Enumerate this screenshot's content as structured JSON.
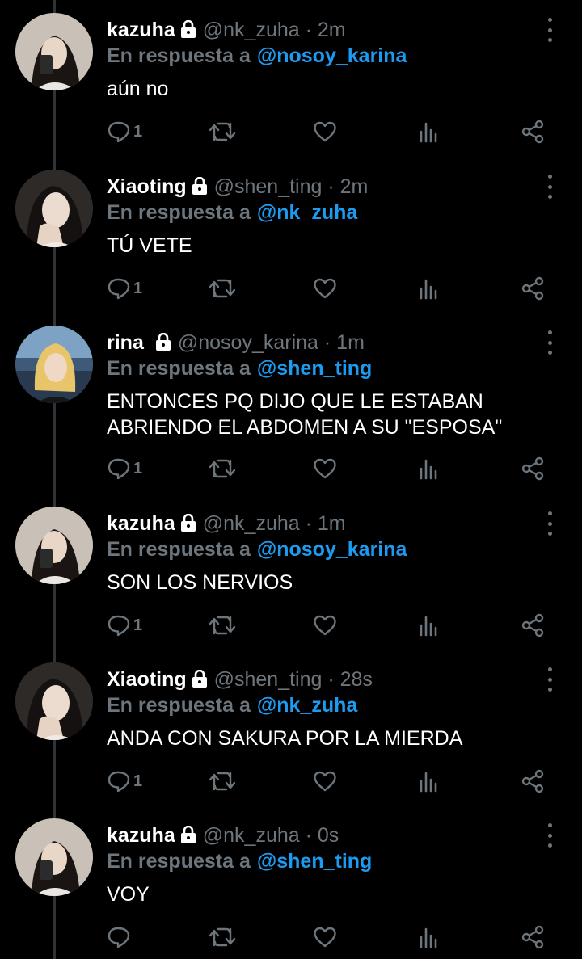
{
  "theme": {
    "background": "#000000",
    "text": "#ffffff",
    "muted": "#6e767d",
    "accent": "#1d9bf0"
  },
  "reply_prefix": "En respuesta a",
  "tweets": [
    {
      "name": "kazuha",
      "handle": "@nk_zuha · 2m",
      "reply_to": "@nosoy_karina",
      "text": "aún no",
      "reply_count": "1",
      "avatar": "kazuha"
    },
    {
      "name": "Xiaoting",
      "handle": "@shen_ting · 2m",
      "reply_to": "@nk_zuha",
      "text": "TÚ VETE",
      "reply_count": "1",
      "avatar": "xiaoting"
    },
    {
      "name": "rina",
      "handle": "@nosoy_karina · 1m",
      "reply_to": "@shen_ting",
      "text": "ENTONCES PQ DIJO QUE LE ESTABAN\nABRIENDO EL ABDOMEN A SU \"ESPOSA\"",
      "reply_count": "1",
      "avatar": "rina"
    },
    {
      "name": "kazuha",
      "handle": "@nk_zuha · 1m",
      "reply_to": "@nosoy_karina",
      "text": "SON LOS NERVIOS",
      "reply_count": "1",
      "avatar": "kazuha"
    },
    {
      "name": "Xiaoting",
      "handle": "@shen_ting · 28s",
      "reply_to": "@nk_zuha",
      "text": "ANDA CON SAKURA POR LA MIERDA",
      "reply_count": "1",
      "avatar": "xiaoting"
    },
    {
      "name": "kazuha",
      "handle": "@nk_zuha · 0s",
      "reply_to": "@shen_ting",
      "text": "VOY",
      "reply_count": "",
      "avatar": "kazuha"
    }
  ],
  "icons": {
    "lock": "lock-icon",
    "more": "more-options-icon",
    "reply": "reply-icon",
    "retweet": "retweet-icon",
    "like": "heart-icon",
    "stats": "analytics-icon",
    "share": "share-icon"
  }
}
